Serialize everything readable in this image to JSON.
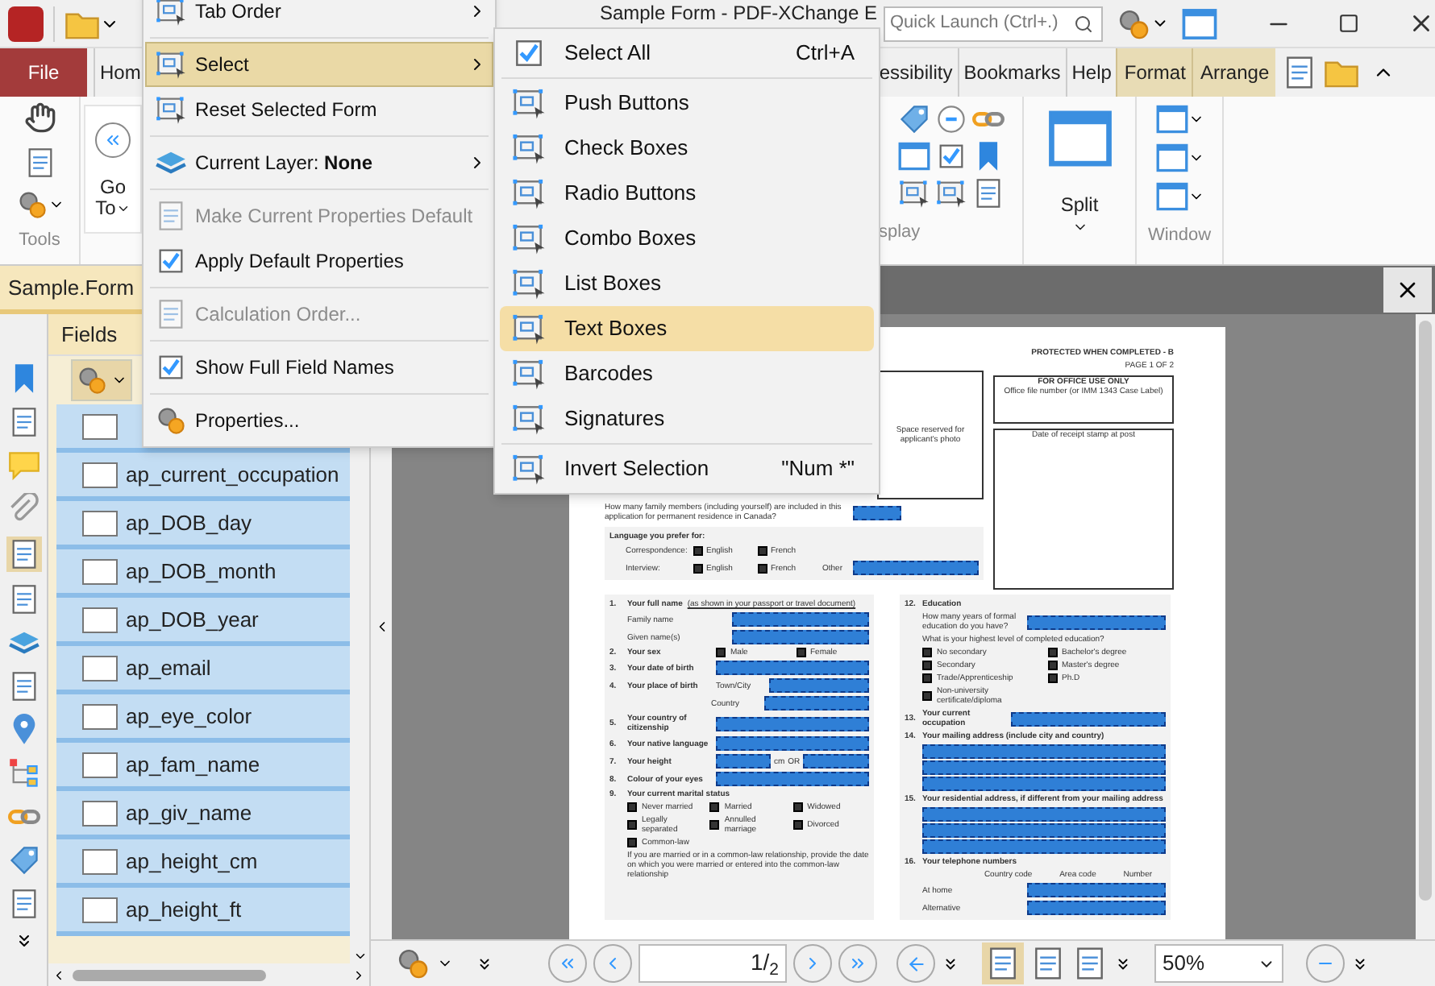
{
  "title_bar": {
    "title": "Sample Form - PDF-XChange E",
    "quick_launch": {
      "placeholder": "Quick Launch (Ctrl+.)"
    }
  },
  "menu_tabs": [
    {
      "label": "File",
      "kind": "file"
    },
    {
      "label": "Hom",
      "kind": "tab"
    },
    {
      "label": "essibility",
      "kind": "tab"
    },
    {
      "label": "Bookmarks",
      "kind": "tab"
    },
    {
      "label": "Help",
      "kind": "tab"
    },
    {
      "label": "Format",
      "kind": "context"
    },
    {
      "label": "Arrange",
      "kind": "context"
    }
  ],
  "ribbon": {
    "tools_label": "Tools",
    "go_to": [
      "Go",
      "To"
    ],
    "display_label": "splay",
    "split": "Split",
    "window_label": "Window"
  },
  "document_tab": {
    "label": "Sample.Form"
  },
  "fields_panel": {
    "title": "Fields",
    "items": [
      {
        "selected": true
      },
      {
        "label": "ap_current_occupation",
        "selected": true
      },
      {
        "label": "ap_DOB_day",
        "selected": true
      },
      {
        "label": "ap_DOB_month",
        "selected": true
      },
      {
        "label": "ap_DOB_year",
        "selected": true
      },
      {
        "label": "ap_email",
        "selected": true
      },
      {
        "label": "ap_eye_color",
        "selected": true
      },
      {
        "label": "ap_fam_name",
        "selected": true
      },
      {
        "label": "ap_giv_name",
        "selected": true
      },
      {
        "label": "ap_height_cm",
        "selected": true
      },
      {
        "label": "ap_height_ft",
        "selected": true
      }
    ]
  },
  "context_menu": [
    {
      "label": "Tab Order",
      "submenu": true,
      "disabled": false,
      "selected": false
    },
    {
      "label": "Select",
      "submenu": true,
      "disabled": false,
      "selected": true
    },
    {
      "label": "Reset Selected Form",
      "submenu": false,
      "disabled": false,
      "selected": false
    },
    {
      "label": "Current Layer: **None**",
      "submenu": true,
      "disabled": false,
      "selected": false
    },
    {
      "label": "Make Current Properties Default",
      "submenu": false,
      "disabled": true,
      "selected": false
    },
    {
      "label": "Apply Default Properties",
      "submenu": false,
      "disabled": false,
      "selected": false
    },
    {
      "label": "Calculation Order...",
      "submenu": false,
      "disabled": true,
      "selected": false
    },
    {
      "label": "Show Full Field Names",
      "submenu": false,
      "disabled": false,
      "selected": false
    },
    {
      "label": "Properties...",
      "submenu": false,
      "disabled": false,
      "selected": false
    }
  ],
  "select_submenu": [
    {
      "label": "Select All",
      "shortcut": "Ctrl+A",
      "selected": false
    },
    {
      "label": "Push Buttons",
      "selected": false
    },
    {
      "label": "Check Boxes",
      "selected": false
    },
    {
      "label": "Radio Buttons",
      "selected": false
    },
    {
      "label": "Combo Boxes",
      "selected": false
    },
    {
      "label": "List Boxes",
      "selected": false
    },
    {
      "label": "Text Boxes",
      "selected": true
    },
    {
      "label": "Barcodes",
      "selected": false
    },
    {
      "label": "Signatures",
      "selected": false
    },
    {
      "label": "Invert Selection",
      "shortcut": "\"Num *\"",
      "selected": false
    }
  ],
  "page": {
    "protected": "PROTECTED WHEN COMPLETED - B",
    "page_label": "PAGE 1 OF 2",
    "photo_box": "Space reserved for applicant's photo",
    "office_title": "FOR OFFICE USE ONLY",
    "office_text": "Office file number (or IMM 1343 Case Label)",
    "stamp_box": "Date of receipt stamp at post",
    "family_question": "How many family members (including yourself) are included in this application for permanent residence in Canada?",
    "language": {
      "title": "Language you prefer for:",
      "rows": [
        {
          "label": "Correspondence:",
          "options": [
            {
              "label": "English",
              "checked": false
            },
            {
              "label": "French",
              "checked": false
            }
          ]
        },
        {
          "label": "Interview:",
          "options": [
            {
              "label": "English",
              "checked": false
            },
            {
              "label": "French",
              "checked": false
            }
          ],
          "other": "Other"
        }
      ]
    },
    "left_questions": [
      {
        "number": "1.",
        "label": "Your full name",
        "note": "(as shown in your passport or travel document)",
        "rows": [
          {
            "kind": "field",
            "label": "Family name"
          },
          {
            "kind": "field",
            "label": "Given name(s)"
          }
        ]
      },
      {
        "number": "2.",
        "label": "Your sex",
        "rows": [
          {
            "kind": "checks",
            "options": [
              {
                "label": "Male",
                "checked": false
              },
              {
                "label": "Female",
                "checked": false
              }
            ]
          }
        ]
      },
      {
        "number": "3.",
        "label": "Your date of birth",
        "rows": [
          {
            "kind": "field"
          }
        ]
      },
      {
        "number": "4.",
        "label": "Your place of birth",
        "rows": [
          {
            "kind": "field",
            "label": "Town/City"
          },
          {
            "kind": "field",
            "label": "Country"
          }
        ]
      },
      {
        "number": "5.",
        "label": "Your country of citizenship",
        "rows": [
          {
            "kind": "field"
          }
        ]
      },
      {
        "number": "6.",
        "label": "Your native language",
        "rows": [
          {
            "kind": "field"
          }
        ]
      },
      {
        "number": "7.",
        "label": "Your height",
        "rows": [
          {
            "kind": "height",
            "unit": "cm",
            "or": "OR"
          }
        ]
      },
      {
        "number": "8.",
        "label": "Colour of your eyes",
        "rows": [
          {
            "kind": "field"
          }
        ]
      },
      {
        "number": "9.",
        "label": "Your current marital status",
        "rows": [
          {
            "kind": "checks",
            "options": [
              {
                "label": "Never married",
                "checked": false
              },
              {
                "label": "Married",
                "checked": false
              },
              {
                "label": "Widowed",
                "checked": false
              },
              {
                "label": "Legally separated",
                "checked": false
              },
              {
                "label": "Annulled marriage",
                "checked": false
              },
              {
                "label": "Divorced",
                "checked": false
              },
              {
                "label": "Common-law",
                "checked": false
              }
            ]
          },
          {
            "kind": "note",
            "text": "If you are married or in a common-law relationship, provide the date on which you were married or entered into the common-law relationship"
          }
        ]
      }
    ],
    "right_questions": [
      {
        "number": "12.",
        "label": "Education",
        "rows": [
          {
            "kind": "field",
            "label": "How many years of formal education do you have?"
          },
          {
            "kind": "note",
            "text": "What is your highest level of completed education?"
          },
          {
            "kind": "checks",
            "options": [
              {
                "label": "No secondary",
                "checked": false
              },
              {
                "label": "Bachelor's degree",
                "checked": false
              },
              {
                "label": "Secondary",
                "checked": false
              },
              {
                "label": "Master's degree",
                "checked": false
              },
              {
                "label": "Trade/Apprenticeship",
                "checked": false
              },
              {
                "label": "Ph.D",
                "checked": false
              },
              {
                "label": "Non-university certificate/diploma",
                "checked": false
              }
            ]
          }
        ]
      },
      {
        "number": "13.",
        "label": "Your current occupation",
        "rows": [
          {
            "kind": "field"
          }
        ]
      },
      {
        "number": "14.",
        "label": "Your mailing address (include city and country)",
        "rows": [
          {
            "kind": "fields"
          }
        ]
      },
      {
        "number": "15.",
        "label": "Your residential address, if different from your mailing address",
        "rows": [
          {
            "kind": "fields"
          }
        ]
      },
      {
        "number": "16.",
        "label": "Your telephone numbers",
        "rows": [
          {
            "kind": "headers",
            "options": [
              "Country code",
              "Area code",
              "Number"
            ]
          },
          {
            "kind": "field",
            "label": "At home"
          },
          {
            "kind": "field",
            "label": "Alternative"
          }
        ]
      }
    ]
  },
  "bottom_toolbar": {
    "page_field": "1/$_{2}$",
    "zoom": "50%"
  }
}
